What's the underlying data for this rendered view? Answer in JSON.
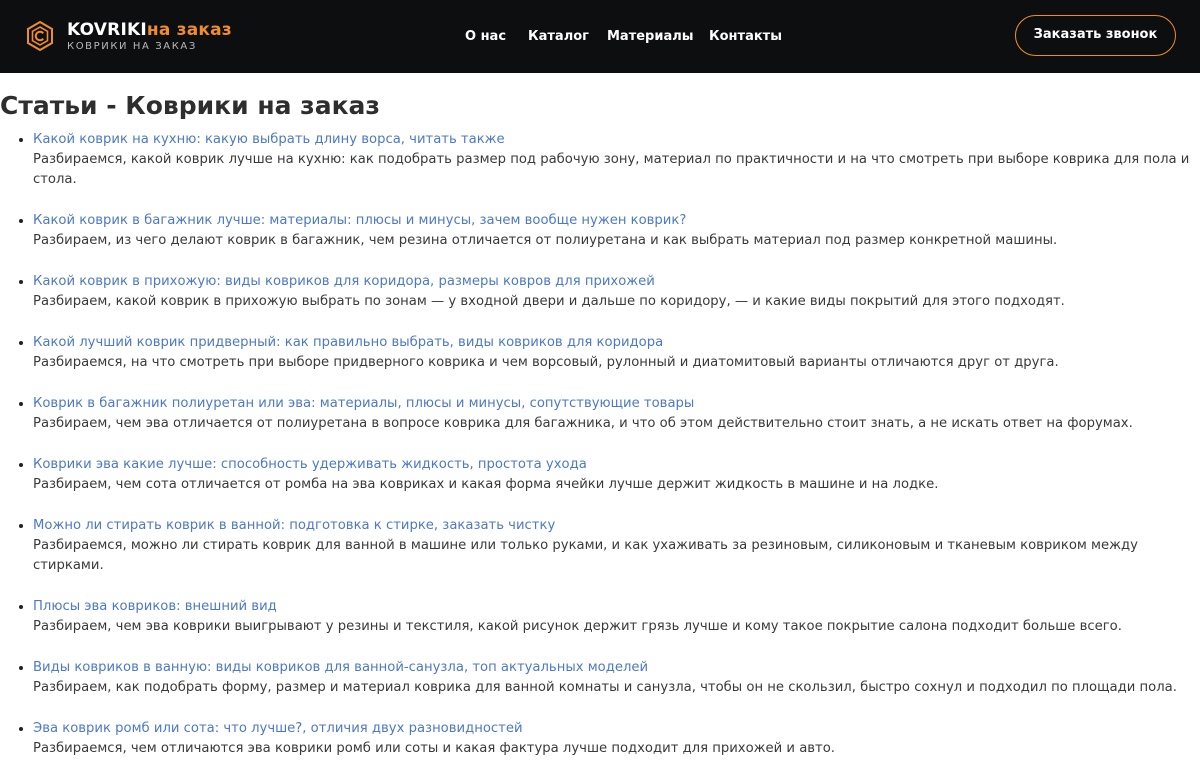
{
  "header": {
    "brand_main_white": "KOVRIKI",
    "brand_main_orange": "на заказ",
    "brand_sub": "КОВРИКИ НА ЗАКАЗ",
    "logo_icon": "hexagon-c-icon",
    "nav": [
      {
        "label": "О нас"
      },
      {
        "label": "Каталог"
      },
      {
        "label": "Материалы"
      },
      {
        "label": "Контакты"
      }
    ],
    "cta_label": "Заказать звонок",
    "colors": {
      "background": "#0d0e10",
      "accent": "#f08c2a"
    }
  },
  "page": {
    "title": "Статьи - Коврики на заказ",
    "link_color": "#4d79c5"
  },
  "articles": [
    {
      "title": "Какой коврик на кухню: какую выбрать длину ворса, читать также",
      "description": "Разбираемся, какой коврик лучше на кухню: как подобрать размер под рабочую зону, материал по практичности и на что смотреть при выборе коврика для пола и стола."
    },
    {
      "title": "Какой коврик в багажник лучше: материалы: плюсы и минусы, зачем вообще нужен коврик?",
      "description": "Разбираем, из чего делают коврик в багажник, чем резина отличается от полиуретана и как выбрать материал под размер конкретной машины."
    },
    {
      "title": "Какой коврик в прихожую: виды ковриков для коридора, размеры ковров для прихожей",
      "description": "Разбираем, какой коврик в прихожую выбрать по зонам — у входной двери и дальше по коридору, — и какие виды покрытий для этого подходят."
    },
    {
      "title": "Какой лучший коврик придверный: как правильно выбрать, виды ковриков для коридора",
      "description": "Разбираемся, на что смотреть при выборе придверного коврика и чем ворсовый, рулонный и диатомитовый варианты отличаются друг от друга."
    },
    {
      "title": "Коврик в багажник полиуретан или эва: материалы, плюсы и минусы, сопутствующие товары",
      "description": "Разбираем, чем эва отличается от полиуретана в вопросе коврика для багажника, и что об этом действительно стоит знать, а не искать ответ на форумах."
    },
    {
      "title": "Коврики эва какие лучше: способность удерживать жидкость, простота ухода",
      "description": "Разбираем, чем сота отличается от ромба на эва ковриках и какая форма ячейки лучше держит жидкость в машине и на лодке."
    },
    {
      "title": "Можно ли стирать коврик в ванной: подготовка к стирке, заказать чистку",
      "description": "Разбираемся, можно ли стирать коврик для ванной в машине или только руками, и как ухаживать за резиновым, силиконовым и тканевым ковриком между стирками."
    },
    {
      "title": "Плюсы эва ковриков: внешний вид",
      "description": "Разбираем, чем эва коврики выигрывают у резины и текстиля, какой рисунок держит грязь лучше и кому такое покрытие салона подходит больше всего."
    },
    {
      "title": "Виды ковриков в ванную: виды ковриков для ванной-санузла, топ актуальных моделей",
      "description": "Разбираем, как подобрать форму, размер и материал коврика для ванной комнаты и санузла, чтобы он не скользил, быстро сохнул и подходил по площади пола."
    },
    {
      "title": "Эва коврик ромб или сота: что лучше?, отличия двух разновидностей",
      "description": "Разбираемся, чем отличаются эва коврики ромб или соты и какая фактура лучше подходит для прихожей и авто."
    }
  ]
}
